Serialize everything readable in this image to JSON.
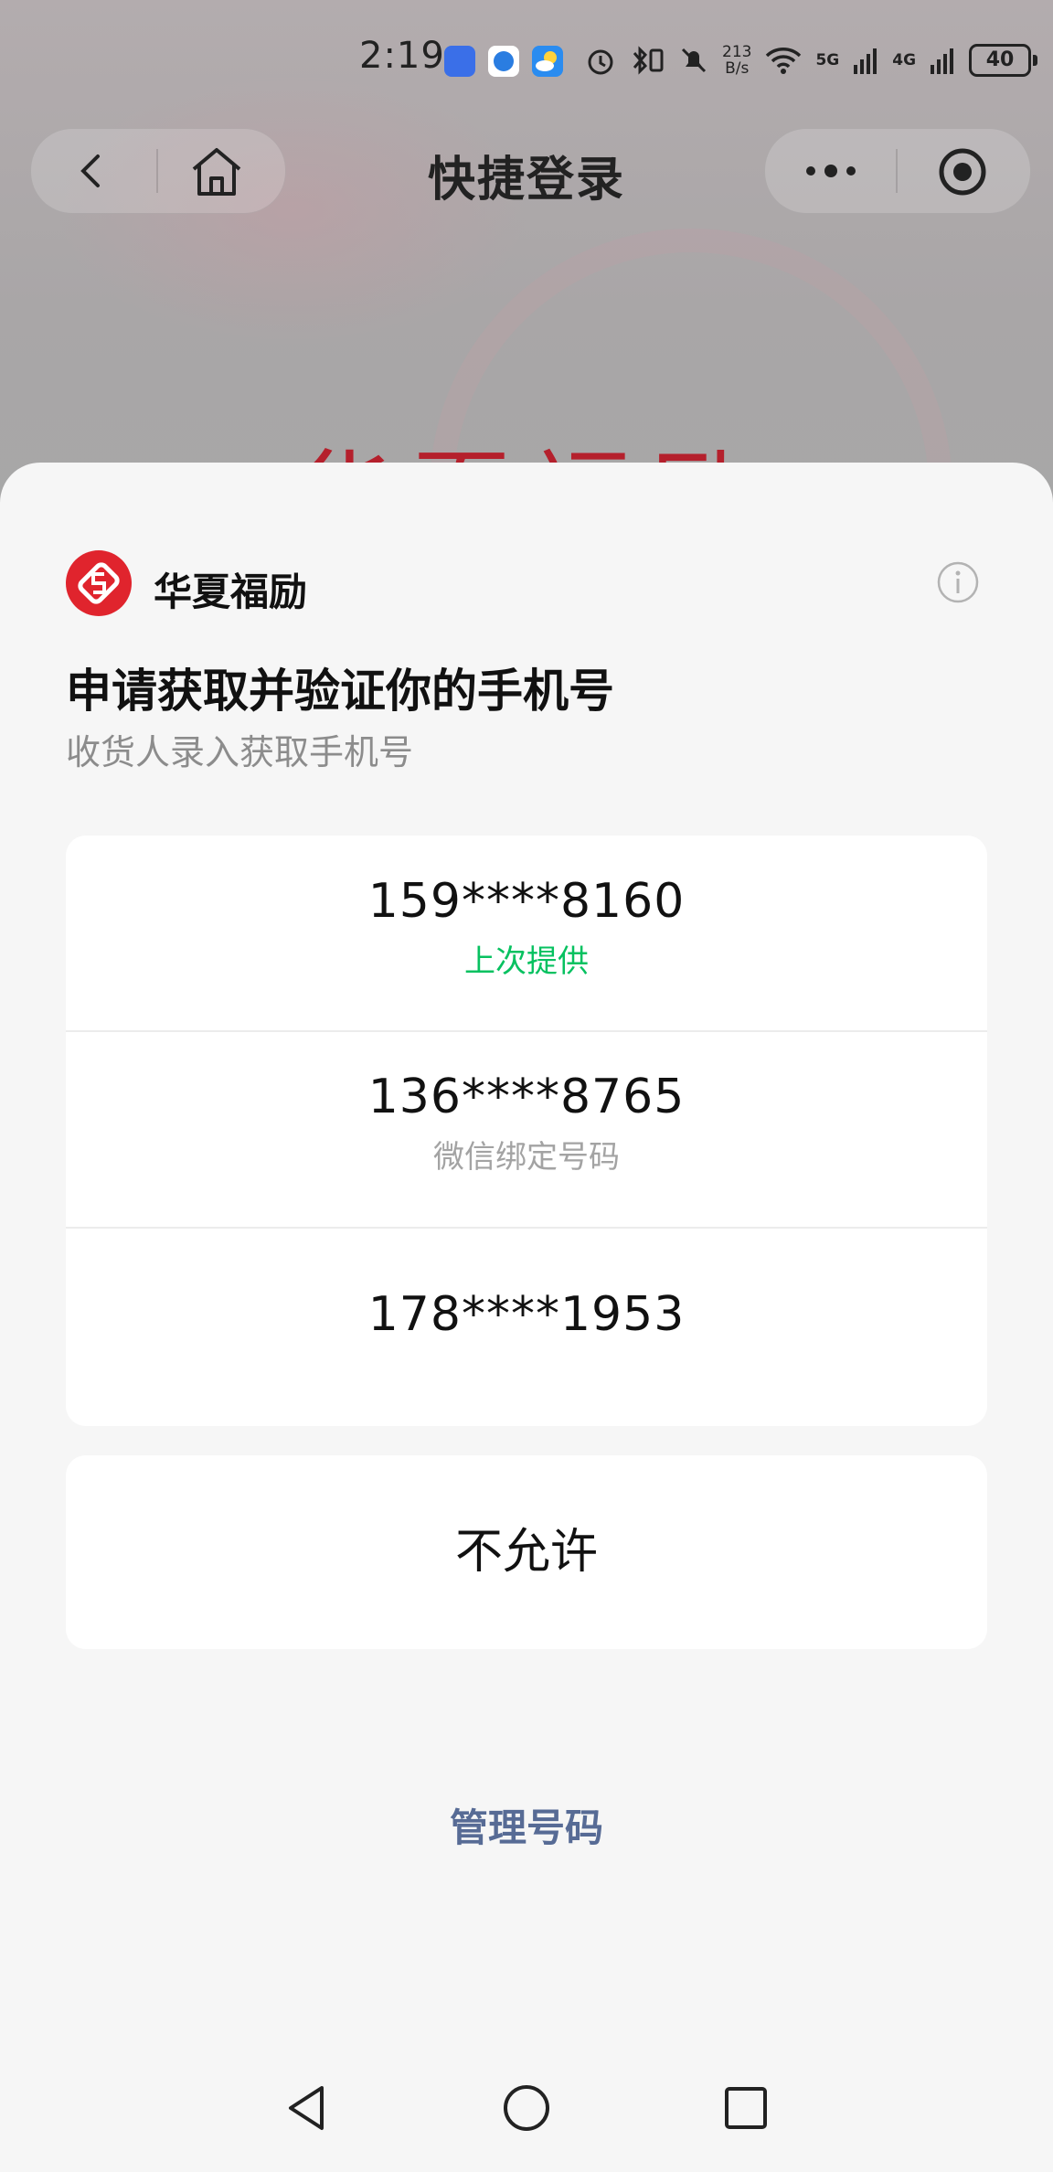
{
  "status_bar": {
    "time": "2:19",
    "net_speed_value": "213",
    "net_speed_unit": "B/s",
    "signal_1": "5G",
    "signal_2": "4G",
    "battery": "40"
  },
  "nav": {
    "title": "快捷登录"
  },
  "background": {
    "brand_text": "华夏福励"
  },
  "sheet": {
    "app_name": "华夏福励",
    "request_title": "申请获取并验证你的手机号",
    "request_subtitle": "收货人录入获取手机号",
    "phones": [
      {
        "number": "159****8160",
        "tag": "上次提供",
        "tag_style": "green"
      },
      {
        "number": "136****8765",
        "tag": "微信绑定号码",
        "tag_style": "gray"
      },
      {
        "number": "178****1953",
        "tag": ""
      }
    ],
    "deny_label": "不允许",
    "manage_label": "管理号码"
  },
  "colors": {
    "accent_green": "#07c160",
    "link_blue": "#576b95",
    "logo_red": "#e0242d"
  }
}
